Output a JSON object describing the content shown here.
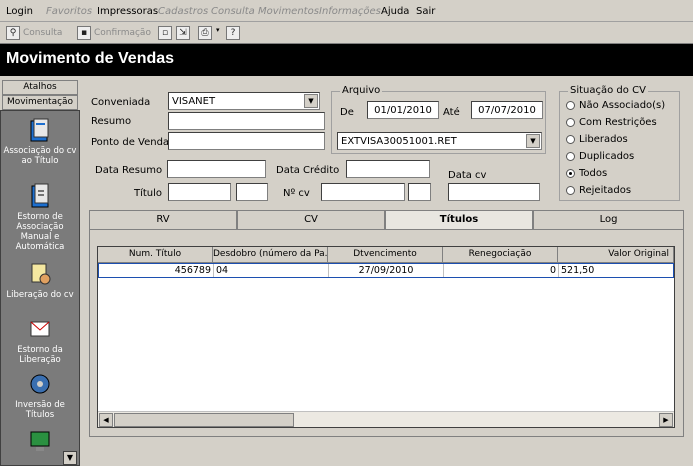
{
  "menu": [
    {
      "label": "Login",
      "disabled": false
    },
    {
      "label": "Favoritos",
      "disabled": true
    },
    {
      "label": "Impressoras",
      "disabled": false
    },
    {
      "label": "Cadastros",
      "disabled": true
    },
    {
      "label": "Consulta",
      "disabled": true
    },
    {
      "label": "Movimentos",
      "disabled": true
    },
    {
      "label": "Informações",
      "disabled": true
    },
    {
      "label": "Ajuda",
      "disabled": false
    },
    {
      "label": "Sair",
      "disabled": false
    }
  ],
  "toolbar": {
    "consulta": "Consulta",
    "confirmacao": "Confirmação"
  },
  "window_title": "Movimento de Vendas",
  "sidebar": {
    "atalhos": "Atalhos",
    "movimentacao": "Movimentação",
    "items": [
      {
        "label": "Associação do cv ao Título",
        "icon": "book-icon"
      },
      {
        "label": "Estorno de Associação Manual e Automática",
        "icon": "book-arrow-icon"
      },
      {
        "label": "Liberação do cv",
        "icon": "document-hand-icon"
      },
      {
        "label": "Estorno da Liberação",
        "icon": "envelope-icon"
      },
      {
        "label": "Inversão de Títulos",
        "icon": "gear-icon"
      },
      {
        "label": "",
        "icon": "monitor-icon"
      }
    ]
  },
  "form": {
    "conveniada_label": "Conveniada",
    "conveniada_value": "VISANET",
    "resumo_label": "Resumo",
    "ponto_venda_label": "Ponto de Venda",
    "data_resumo_label": "Data Resumo",
    "data_credito_label": "Data Crédito",
    "data_cv_label": "Data cv",
    "titulo_label": "Título",
    "ncv_label": "Nº cv"
  },
  "arquivo": {
    "title": "Arquivo",
    "de_label": "De",
    "de_value": "01/01/2010",
    "ate_label": "Até",
    "ate_value": "07/07/2010",
    "file_value": "EXTVISA30051001.RET"
  },
  "situacao": {
    "title": "Situação do CV",
    "options": [
      "Não Associado(s)",
      "Com Restrições",
      "Liberados",
      "Duplicados",
      "Todos",
      "Rejeitados"
    ],
    "selected": "Todos"
  },
  "tabs": [
    "RV",
    "CV",
    "Títulos",
    "Log"
  ],
  "active_tab": "Títulos",
  "grid": {
    "columns": [
      "Num. Título",
      "Desdobro (número da Pa...",
      "Dtvencimento",
      "Renegociação",
      "Valor Original"
    ],
    "rows": [
      [
        "456789",
        "04",
        "27/09/2010",
        "0",
        "521,50"
      ]
    ]
  }
}
